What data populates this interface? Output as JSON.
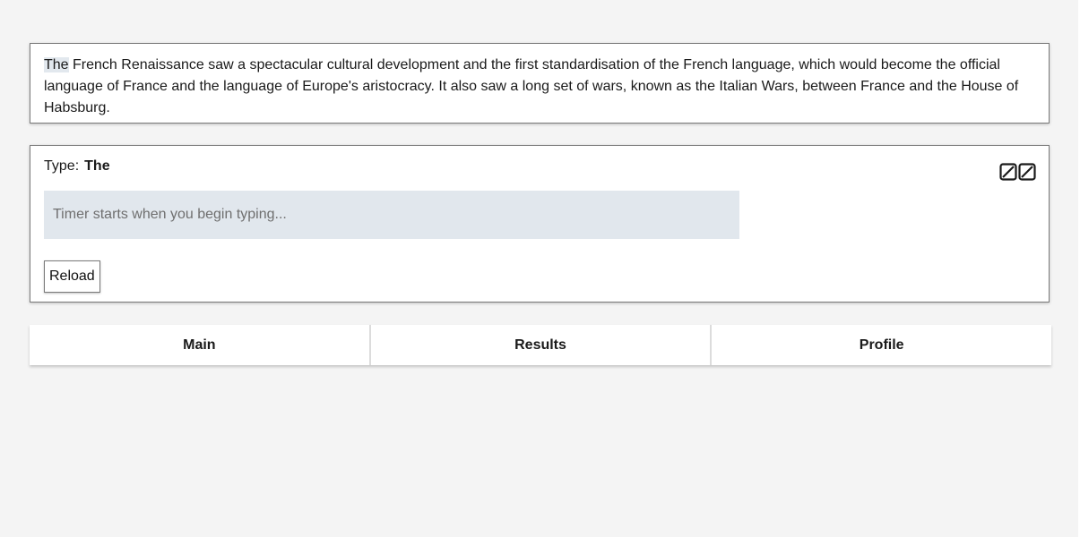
{
  "passage": {
    "current_word": "The",
    "remaining_text": " French Renaissance saw a spectacular cultural development and the first standardisation of the French language, which would become the official language of France and the language of Europe's aristocracy. It also saw a long set of wars, known as the Italian Wars, between France and the House of Habsburg."
  },
  "typing": {
    "label": "Type:",
    "target_word": "The",
    "placeholder": "Timer starts when you begin typing...",
    "value": "",
    "reload_label": "Reload",
    "layout_icon": "layout-toggle-icon"
  },
  "nav": {
    "tabs": [
      {
        "label": "Main"
      },
      {
        "label": "Results"
      },
      {
        "label": "Profile"
      }
    ]
  },
  "colors": {
    "background": "#f4f4f4",
    "panel": "#ffffff",
    "input_bg": "#e1e7ed",
    "highlight": "#e2e8ee"
  }
}
